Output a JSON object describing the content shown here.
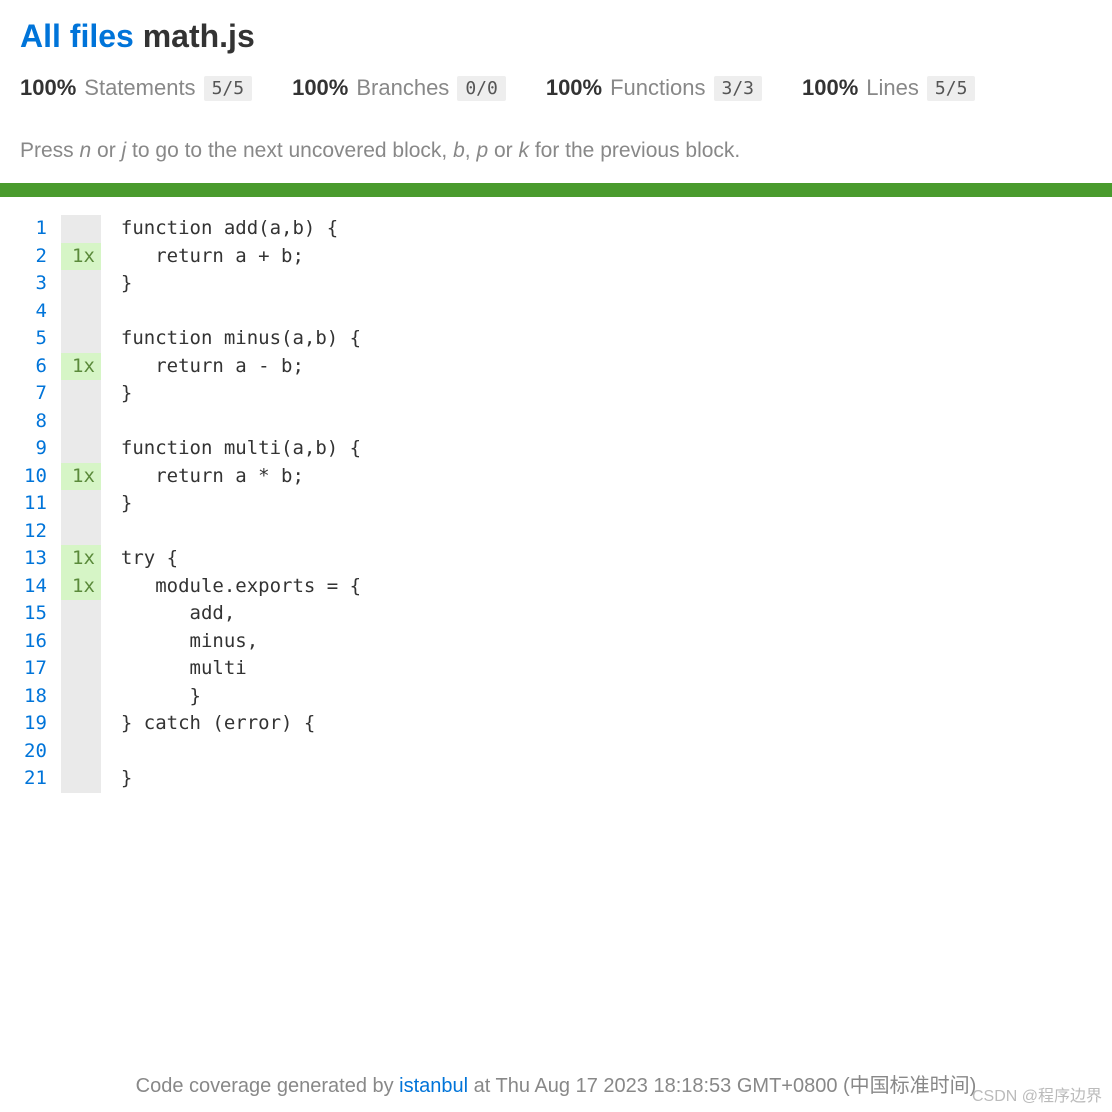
{
  "breadcrumb": {
    "root": "All files",
    "current": "math.js"
  },
  "stats": {
    "statements": {
      "pct": "100%",
      "label": "Statements",
      "fraction": "5/5"
    },
    "branches": {
      "pct": "100%",
      "label": "Branches",
      "fraction": "0/0"
    },
    "functions": {
      "pct": "100%",
      "label": "Functions",
      "fraction": "3/3"
    },
    "lines": {
      "pct": "100%",
      "label": "Lines",
      "fraction": "5/5"
    }
  },
  "hint": {
    "prefix": "Press ",
    "k1": "n",
    "sep1": " or ",
    "k2": "j",
    "mid": " to go to the next uncovered block, ",
    "k3": "b",
    "sep2": ", ",
    "k4": "p",
    "sep3": " or ",
    "k5": "k",
    "suffix": " for the previous block."
  },
  "code": {
    "lines": [
      {
        "n": "1",
        "hit": "",
        "text": "function add(a,b) {"
      },
      {
        "n": "2",
        "hit": "1x",
        "text": "   return a + b;"
      },
      {
        "n": "3",
        "hit": "",
        "text": "}"
      },
      {
        "n": "4",
        "hit": "",
        "text": ""
      },
      {
        "n": "5",
        "hit": "",
        "text": "function minus(a,b) {"
      },
      {
        "n": "6",
        "hit": "1x",
        "text": "   return a - b;"
      },
      {
        "n": "7",
        "hit": "",
        "text": "}"
      },
      {
        "n": "8",
        "hit": "",
        "text": ""
      },
      {
        "n": "9",
        "hit": "",
        "text": "function multi(a,b) {"
      },
      {
        "n": "10",
        "hit": "1x",
        "text": "   return a * b;"
      },
      {
        "n": "11",
        "hit": "",
        "text": "}"
      },
      {
        "n": "12",
        "hit": "",
        "text": ""
      },
      {
        "n": "13",
        "hit": "1x",
        "text": "try {"
      },
      {
        "n": "14",
        "hit": "1x",
        "text": "   module.exports = {"
      },
      {
        "n": "15",
        "hit": "",
        "text": "      add,"
      },
      {
        "n": "16",
        "hit": "",
        "text": "      minus,"
      },
      {
        "n": "17",
        "hit": "",
        "text": "      multi"
      },
      {
        "n": "18",
        "hit": "",
        "text": "      }"
      },
      {
        "n": "19",
        "hit": "",
        "text": "} catch (error) {"
      },
      {
        "n": "20",
        "hit": "",
        "text": ""
      },
      {
        "n": "21",
        "hit": "",
        "text": "}"
      }
    ]
  },
  "footer": {
    "prefix": "Code coverage generated by ",
    "tool": "istanbul",
    "at": " at Thu Aug 17 2023 18:18:53 GMT+0800 (中国标准时间)"
  },
  "watermark": "CSDN @程序边界"
}
